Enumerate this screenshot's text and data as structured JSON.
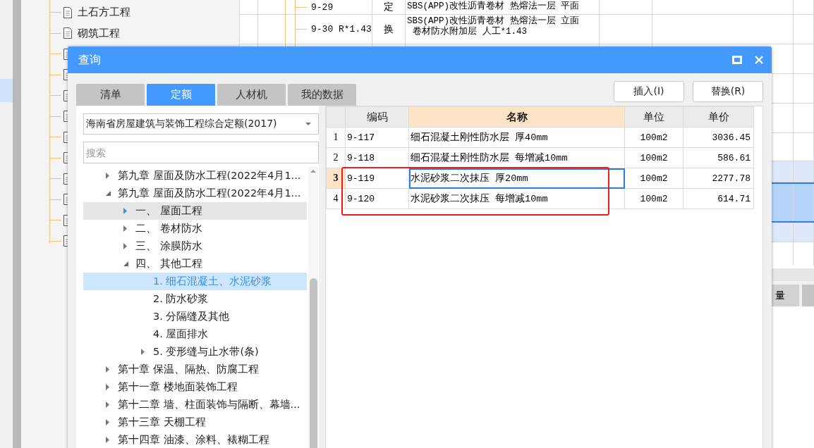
{
  "background": {
    "tree_items": [
      {
        "label": "土石方工程"
      },
      {
        "label": "砌筑工程"
      }
    ],
    "table_rows": [
      {
        "code": "9-29",
        "type": "定",
        "description_lines": [
          "SBS(APP)改性沥青卷材 热熔法一层 平面"
        ]
      },
      {
        "code": "9-30 R*1.43",
        "type": "换",
        "description_lines": [
          "SBS(APP)改性沥青卷材 热熔法一层 立面",
          "卷材防水附加层 人工*1.43"
        ]
      }
    ],
    "bottom_tab": "量"
  },
  "dialog": {
    "title": "查询",
    "tabs": [
      {
        "label": "清单",
        "selected": false
      },
      {
        "label": "定额",
        "selected": true
      },
      {
        "label": "人材机",
        "selected": false
      },
      {
        "label": "我的数据",
        "selected": false
      }
    ],
    "buttons": [
      "插入(I)",
      "替换(R)"
    ],
    "library_select": {
      "value": "海南省房屋建筑与装饰工程综合定额(2017)"
    },
    "search": {
      "placeholder": "搜索"
    },
    "tree": [
      {
        "label": "第九章 屋面及防水工程(2022年4月1...",
        "kind": "folder",
        "expanded": false,
        "selected": false,
        "hovered": false
      },
      {
        "label": "第九章 屋面及防水工程(2022年4月1...",
        "kind": "folder",
        "expanded": true,
        "selected": false,
        "hovered": false,
        "children": [
          {
            "label": "一、 屋面工程",
            "kind": "folder",
            "expanded": false,
            "selected": false,
            "hovered": true
          },
          {
            "label": "二、 卷材防水",
            "kind": "folder",
            "expanded": false,
            "selected": false,
            "hovered": false
          },
          {
            "label": "三、 涂膜防水",
            "kind": "folder",
            "expanded": false,
            "selected": false,
            "hovered": false
          },
          {
            "label": "四、 其他工程",
            "kind": "folder",
            "expanded": true,
            "selected": false,
            "hovered": false,
            "children": [
              {
                "label": "1. 细石混凝土、水泥砂浆",
                "kind": "leaf",
                "selected": true,
                "hovered": false
              },
              {
                "label": "2. 防水砂浆",
                "kind": "leaf",
                "selected": false,
                "hovered": false
              },
              {
                "label": "3. 分隔缝及其他",
                "kind": "leaf",
                "selected": false,
                "hovered": false
              },
              {
                "label": "4. 屋面排水",
                "kind": "leaf",
                "selected": false,
                "hovered": false
              },
              {
                "label": "5. 变形缝与止水带(条)",
                "kind": "folder",
                "expanded": false,
                "selected": false,
                "hovered": false
              }
            ]
          }
        ]
      },
      {
        "label": "第十章 保温、隔热、防腐工程",
        "kind": "folder",
        "expanded": false,
        "selected": false,
        "hovered": false
      },
      {
        "label": "第十一章 楼地面装饰工程",
        "kind": "folder",
        "expanded": false,
        "selected": false,
        "hovered": false
      },
      {
        "label": "第十二章 墙、柱面装饰与隔断、幕墙...",
        "kind": "folder",
        "expanded": false,
        "selected": false,
        "hovered": false
      },
      {
        "label": "第十三章 天棚工程",
        "kind": "folder",
        "expanded": false,
        "selected": false,
        "hovered": false
      },
      {
        "label": "第十四章 油漆、涂料、裱糊工程",
        "kind": "folder",
        "expanded": false,
        "selected": false,
        "hovered": false
      }
    ],
    "table": {
      "columns": [
        {
          "label": "编码",
          "selected": false
        },
        {
          "label": "名称",
          "selected": true
        },
        {
          "label": "单位",
          "selected": false
        },
        {
          "label": "单价",
          "selected": false
        }
      ],
      "rows": [
        {
          "index": "1",
          "code": "9-117",
          "name": "细石混凝土刚性防水层 厚40mm",
          "unit": "100m2",
          "price": "3036.45",
          "selected": false
        },
        {
          "index": "2",
          "code": "9-118",
          "name": "细石混凝土刚性防水层 每增减10mm",
          "unit": "100m2",
          "price": "586.61",
          "selected": false
        },
        {
          "index": "3",
          "code": "9-119",
          "name": "水泥砂浆二次抹压 厚20mm",
          "unit": "100m2",
          "price": "2277.78",
          "selected": true
        },
        {
          "index": "4",
          "code": "9-120",
          "name": "水泥砂浆二次抹压 每增减10mm",
          "unit": "100m2",
          "price": "614.71",
          "selected": false
        }
      ]
    }
  }
}
